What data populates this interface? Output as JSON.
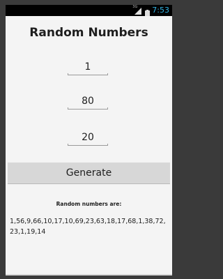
{
  "status_bar": {
    "network_label": "3G",
    "time": "7:53"
  },
  "app": {
    "title": "Random Numbers",
    "fields": [
      {
        "value": "1"
      },
      {
        "value": "80"
      },
      {
        "value": "20"
      }
    ],
    "generate_label": "Generate",
    "result_label": "Random numbers are:",
    "result_text": "1,56,9,66,10,17,10,69,23,63,18,17,68,1,38,72,23,1,19,14"
  },
  "colors": {
    "accent": "#33b5e5",
    "background": "#f4f4f4",
    "button": "#d7d7d7"
  }
}
